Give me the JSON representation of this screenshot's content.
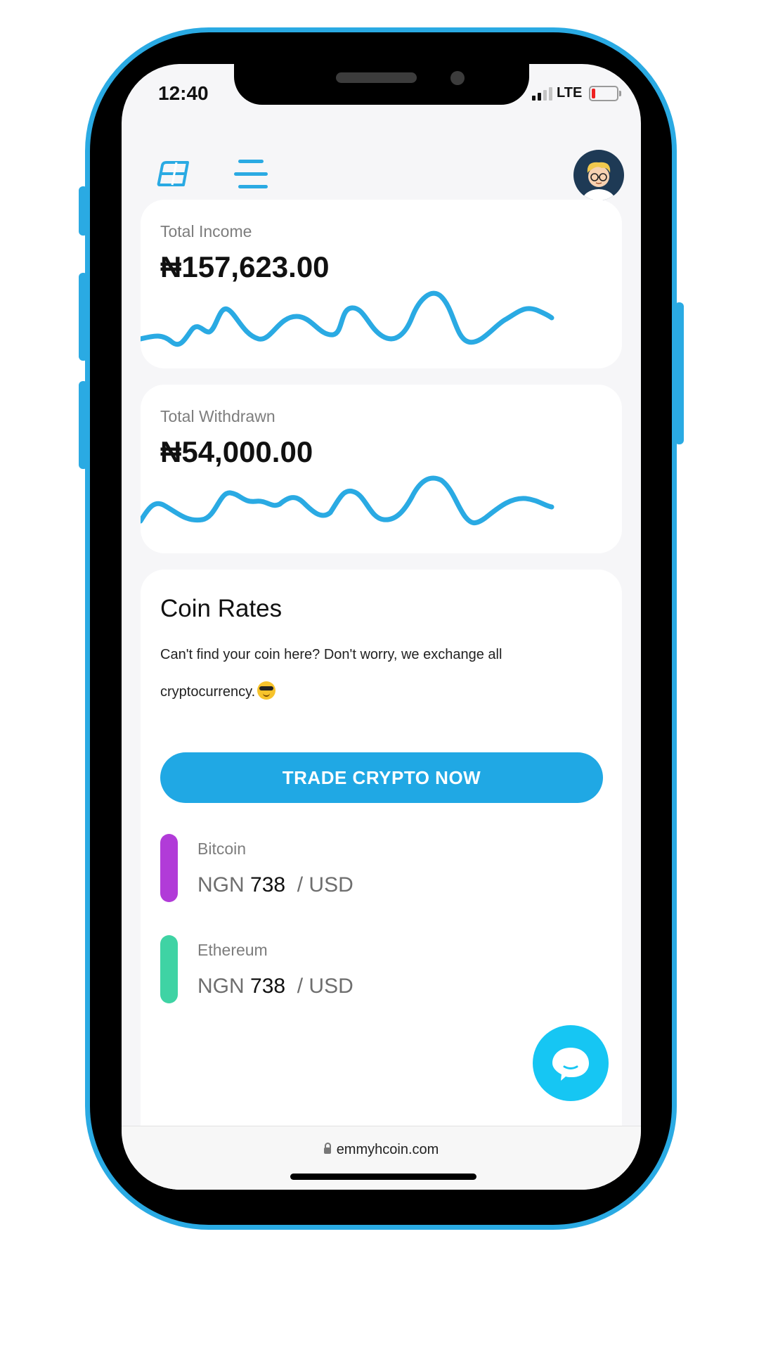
{
  "status_bar": {
    "time": "12:40",
    "network": "LTE"
  },
  "header": {
    "logo_icon": "ej-logo-icon",
    "menu_icon": "hamburger-menu-icon",
    "avatar_icon": "user-avatar-icon"
  },
  "cards": [
    {
      "label": "Total Income",
      "value": "₦157,623.00"
    },
    {
      "label": "Total Withdrawn",
      "value": "₦54,000.00"
    }
  ],
  "coin_rates": {
    "title": "Coin Rates",
    "description": "Can't find your coin here? Don't worry, we exchange all cryptocurrency.",
    "trade_button": "TRADE CRYPTO NOW",
    "coins": [
      {
        "name": "Bitcoin",
        "currency": "NGN",
        "rate": "738",
        "unit": "/ USD",
        "color": "#b13bd8"
      },
      {
        "name": "Ethereum",
        "currency": "NGN",
        "rate": "738",
        "unit": "/ USD",
        "color": "#3fd3a4"
      }
    ]
  },
  "address_bar": {
    "url": "emmyhcoin.com"
  },
  "colors": {
    "accent": "#2aaae3",
    "button": "#20a8e4",
    "chat": "#16c6f3"
  }
}
